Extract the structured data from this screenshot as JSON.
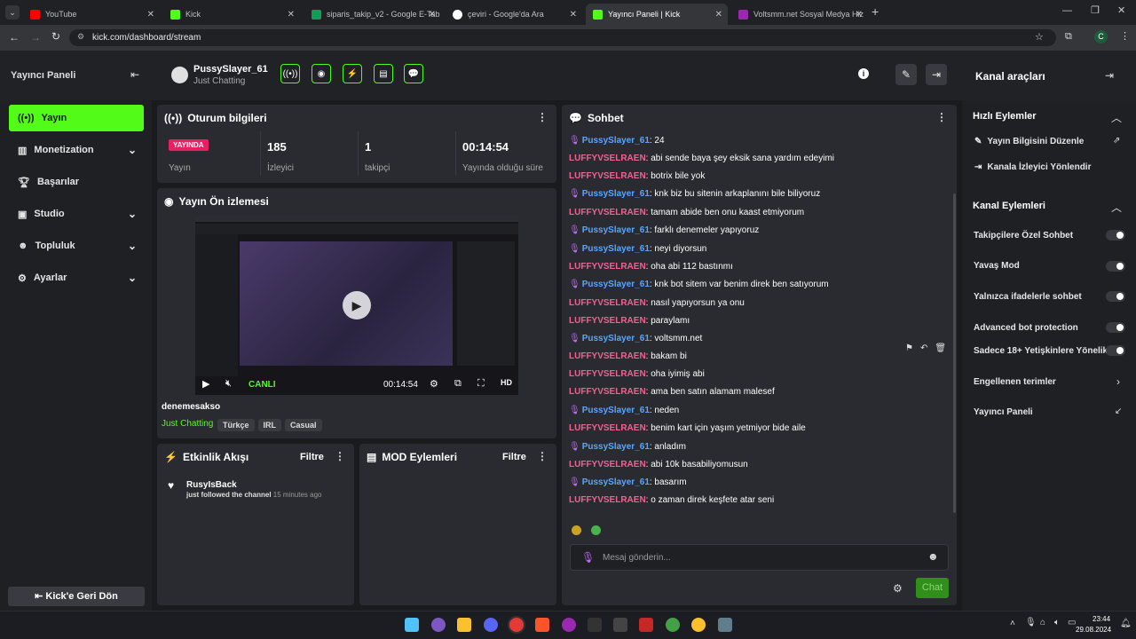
{
  "tabs": [
    {
      "label": "YouTube",
      "color": "#ff0000"
    },
    {
      "label": "Kick",
      "color": "#53fc18"
    },
    {
      "label": "siparis_takip_v2 - Google E-Tab",
      "color": "#0f9d58"
    },
    {
      "label": "çeviri - Google'da Ara",
      "color": "#ffffff"
    },
    {
      "label": "Yayıncı Paneli | Kick",
      "color": "#53fc18"
    },
    {
      "label": "Voltsmm.net Sosyal Medya Hiz",
      "color": "#9c27b0"
    }
  ],
  "url": "kick.com/dashboard/stream",
  "profile_initial": "C",
  "header": {
    "panel_title": "Yayıncı Paneli",
    "username": "PussySlayer_61",
    "category": "Just Chatting",
    "channel_tools": "Kanal araçları"
  },
  "nav": {
    "items": [
      "Yayın",
      "Monetization",
      "Başarılar",
      "Studio",
      "Topluluk",
      "Ayarlar"
    ],
    "back": "Kick'e Geri Dön"
  },
  "session": {
    "title": "Oturum bilgileri",
    "live_badge": "YAYINDA",
    "live_label": "Yayın",
    "viewers": "185",
    "viewers_label": "İzleyici",
    "followers": "1",
    "followers_label": "takipçi",
    "duration": "00:14:54",
    "duration_label": "Yayında olduğu süre"
  },
  "preview": {
    "title": "Yayın Ön izlemesi",
    "canli": "CANLI",
    "time": "00:14:54",
    "stream_title": "denemesakso",
    "category": "Just Chatting",
    "tags": [
      "Türkçe",
      "IRL",
      "Casual"
    ]
  },
  "activity": {
    "title": "Etkinlik Akışı",
    "filter": "Filtre",
    "user": "RusyIsBack",
    "action": "just followed the channel",
    "time": "15 minutes ago"
  },
  "mod": {
    "title": "MOD Eylemleri",
    "filter": "Filtre"
  },
  "chat": {
    "title": "Sohbet",
    "placeholder": "Mesaj gönderin...",
    "send": "Chat",
    "messages": [
      {
        "user": "PussySlayer_61",
        "text": ": 24",
        "mod": true
      },
      {
        "user": "LUFFYVSELRAEN",
        "text": ": abi sende baya şey eksik sana yardım edeyimi",
        "mod": false
      },
      {
        "user": "LUFFYVSELRAEN",
        "text": ": botrix bile yok",
        "mod": false
      },
      {
        "user": "PussySlayer_61",
        "text": ": knk biz bu sitenin arkaplanını bile biliyoruz",
        "mod": true
      },
      {
        "user": "LUFFYVSELRAEN",
        "text": ": tamam abide ben onu kaast etmiyorum",
        "mod": false
      },
      {
        "user": "PussySlayer_61",
        "text": ": farklı denemeler yapıyoruz",
        "mod": true
      },
      {
        "user": "PussySlayer_61",
        "text": ": neyi diyorsun",
        "mod": true
      },
      {
        "user": "LUFFYVSELRAEN",
        "text": ": oha abi 112 bastınmı",
        "mod": false
      },
      {
        "user": "PussySlayer_61",
        "text": ": knk bot sitem var benim direk ben satıyorum",
        "mod": true
      },
      {
        "user": "LUFFYVSELRAEN",
        "text": ": nasıl yapıyorsun ya onu",
        "mod": false
      },
      {
        "user": "LUFFYVSELRAEN",
        "text": ": paraylamı",
        "mod": false
      },
      {
        "user": "PussySlayer_61",
        "text": ": voltsmm.net",
        "mod": true
      },
      {
        "user": "LUFFYVSELRAEN",
        "text": ": bakam bi",
        "mod": false
      },
      {
        "user": "LUFFYVSELRAEN",
        "text": ": oha iyimiş abi",
        "mod": false
      },
      {
        "user": "LUFFYVSELRAEN",
        "text": ": ama ben satın alamam malesef",
        "mod": false
      },
      {
        "user": "PussySlayer_61",
        "text": ": neden",
        "mod": true
      },
      {
        "user": "LUFFYVSELRAEN",
        "text": ": benim kart için yaşım yetmiyor bide aile",
        "mod": false
      },
      {
        "user": "PussySlayer_61",
        "text": ": anladım",
        "mod": true
      },
      {
        "user": "LUFFYVSELRAEN",
        "text": ": abi 10k basabiliyomusun",
        "mod": false
      },
      {
        "user": "PussySlayer_61",
        "text": ": basarım",
        "mod": true
      },
      {
        "user": "LUFFYVSELRAEN",
        "text": ": o zaman direk keşfete atar seni",
        "mod": false
      }
    ]
  },
  "quick_actions": {
    "title": "Hızlı Eylemler",
    "items": [
      "Yayın Bilgisini Düzenle",
      "Kanala İzleyici Yönlendir"
    ]
  },
  "channel_actions": {
    "title": "Kanal Eylemleri",
    "toggles": [
      "Takipçilere Özel Sohbet",
      "Yavaş Mod",
      "Yalnızca ifadelerle sohbet",
      "Advanced bot protection",
      "Sadece 18+ Yetişkinlere Yönelik"
    ],
    "links": [
      "Engellenen terimler",
      "Yayıncı Paneli"
    ]
  },
  "taskbar": {
    "time": "23:44",
    "date": "29.08.2024"
  }
}
